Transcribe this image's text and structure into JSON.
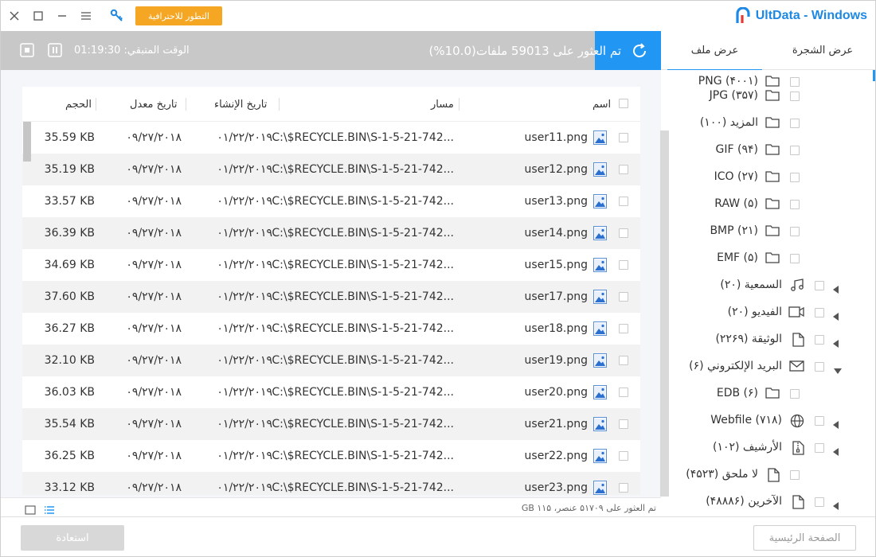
{
  "window": {
    "brand": "UltData - Windows",
    "pro_button": "التطور للاحترافية"
  },
  "progress": {
    "status_text": "تم العثور على 59013 ملفات(10.0%)",
    "fraction": 0.1,
    "remaining_label": "الوقت المتبقي: 01:19:30",
    "fill_color": "#2196f3"
  },
  "tabs": {
    "tree_view": "عرض الشجرة",
    "file_view": "عرض ملف"
  },
  "tree": [
    {
      "label": "PNG (۴۰۰۱)",
      "icon": "folder-icon",
      "partial": true
    },
    {
      "label": "JPG (۳۵۷)",
      "icon": "folder-icon"
    },
    {
      "label": "المزيد (۱۰۰)",
      "icon": "folder-icon"
    },
    {
      "label": "GIF (۹۴)",
      "icon": "folder-icon"
    },
    {
      "label": "ICO (۲۷)",
      "icon": "folder-icon"
    },
    {
      "label": "RAW (۵)",
      "icon": "folder-icon"
    },
    {
      "label": "BMP (۲۱)",
      "icon": "folder-icon"
    },
    {
      "label": "EMF (۵)",
      "icon": "folder-icon"
    },
    {
      "label": "السمعية (۲۰)",
      "icon": "music-icon",
      "expand": "collapsed"
    },
    {
      "label": "الفيديو (۲۰)",
      "icon": "video-icon",
      "expand": "collapsed"
    },
    {
      "label": "الوثيقة (۲۲۶۹)",
      "icon": "document-icon",
      "expand": "collapsed"
    },
    {
      "label": "البريد الإلكتروني (۶)",
      "icon": "mail-icon",
      "expand": "expanded"
    },
    {
      "label": "EDB (۶)",
      "icon": "folder-icon"
    },
    {
      "label": "Webfile (۷۱۸)",
      "icon": "globe-icon",
      "expand": "collapsed"
    },
    {
      "label": "الأرشيف (۱۰۲)",
      "icon": "archive-icon",
      "expand": "collapsed"
    },
    {
      "label": "لا ملحق (۴۵۲۳)",
      "icon": "document-icon"
    },
    {
      "label": "الآخرين (۴۸۸۸۶)",
      "icon": "document-icon",
      "expand": "collapsed"
    }
  ],
  "table": {
    "headers": {
      "name": "اسم",
      "path": "مسار",
      "created": "تاريخ الإنشاء",
      "modified": "تاريخ معدل",
      "size": "الحجم"
    },
    "rows": [
      {
        "name": "user11.png",
        "path": "C:\\$RECYCLE.BIN\\S-1-5-21-742...",
        "created": "۰۱/۲۲/۲۰۱۹",
        "modified": "۰۹/۲۷/۲۰۱۸",
        "size": "35.59 KB"
      },
      {
        "name": "user12.png",
        "path": "C:\\$RECYCLE.BIN\\S-1-5-21-742...",
        "created": "۰۱/۲۲/۲۰۱۹",
        "modified": "۰۹/۲۷/۲۰۱۸",
        "size": "35.19 KB"
      },
      {
        "name": "user13.png",
        "path": "C:\\$RECYCLE.BIN\\S-1-5-21-742...",
        "created": "۰۱/۲۲/۲۰۱۹",
        "modified": "۰۹/۲۷/۲۰۱۸",
        "size": "33.57 KB"
      },
      {
        "name": "user14.png",
        "path": "C:\\$RECYCLE.BIN\\S-1-5-21-742...",
        "created": "۰۱/۲۲/۲۰۱۹",
        "modified": "۰۹/۲۷/۲۰۱۸",
        "size": "36.39 KB"
      },
      {
        "name": "user15.png",
        "path": "C:\\$RECYCLE.BIN\\S-1-5-21-742...",
        "created": "۰۱/۲۲/۲۰۱۹",
        "modified": "۰۹/۲۷/۲۰۱۸",
        "size": "34.69 KB"
      },
      {
        "name": "user17.png",
        "path": "C:\\$RECYCLE.BIN\\S-1-5-21-742...",
        "created": "۰۱/۲۲/۲۰۱۹",
        "modified": "۰۹/۲۷/۲۰۱۸",
        "size": "37.60 KB"
      },
      {
        "name": "user18.png",
        "path": "C:\\$RECYCLE.BIN\\S-1-5-21-742...",
        "created": "۰۱/۲۲/۲۰۱۹",
        "modified": "۰۹/۲۷/۲۰۱۸",
        "size": "36.27 KB"
      },
      {
        "name": "user19.png",
        "path": "C:\\$RECYCLE.BIN\\S-1-5-21-742...",
        "created": "۰۱/۲۲/۲۰۱۹",
        "modified": "۰۹/۲۷/۲۰۱۸",
        "size": "32.10 KB"
      },
      {
        "name": "user20.png",
        "path": "C:\\$RECYCLE.BIN\\S-1-5-21-742...",
        "created": "۰۱/۲۲/۲۰۱۹",
        "modified": "۰۹/۲۷/۲۰۱۸",
        "size": "36.03 KB"
      },
      {
        "name": "user21.png",
        "path": "C:\\$RECYCLE.BIN\\S-1-5-21-742...",
        "created": "۰۱/۲۲/۲۰۱۹",
        "modified": "۰۹/۲۷/۲۰۱۸",
        "size": "35.54 KB"
      },
      {
        "name": "user22.png",
        "path": "C:\\$RECYCLE.BIN\\S-1-5-21-742...",
        "created": "۰۱/۲۲/۲۰۱۹",
        "modified": "۰۹/۲۷/۲۰۱۸",
        "size": "36.25 KB"
      },
      {
        "name": "user23.png",
        "path": "C:\\$RECYCLE.BIN\\S-1-5-21-742...",
        "created": "۰۱/۲۲/۲۰۱۹",
        "modified": "۰۹/۲۷/۲۰۱۸",
        "size": "33.12 KB"
      }
    ]
  },
  "status": {
    "found_text": "تم العثور على ۵۱۷۰۹ عنصر، ۱۱۵ GB"
  },
  "bottom": {
    "recover": "استعادة",
    "home": "الصفحة الرئيسية"
  },
  "colors": {
    "accent": "#2196f3",
    "pro_orange": "#f5a623",
    "progress_gray": "#c8c8c8"
  }
}
